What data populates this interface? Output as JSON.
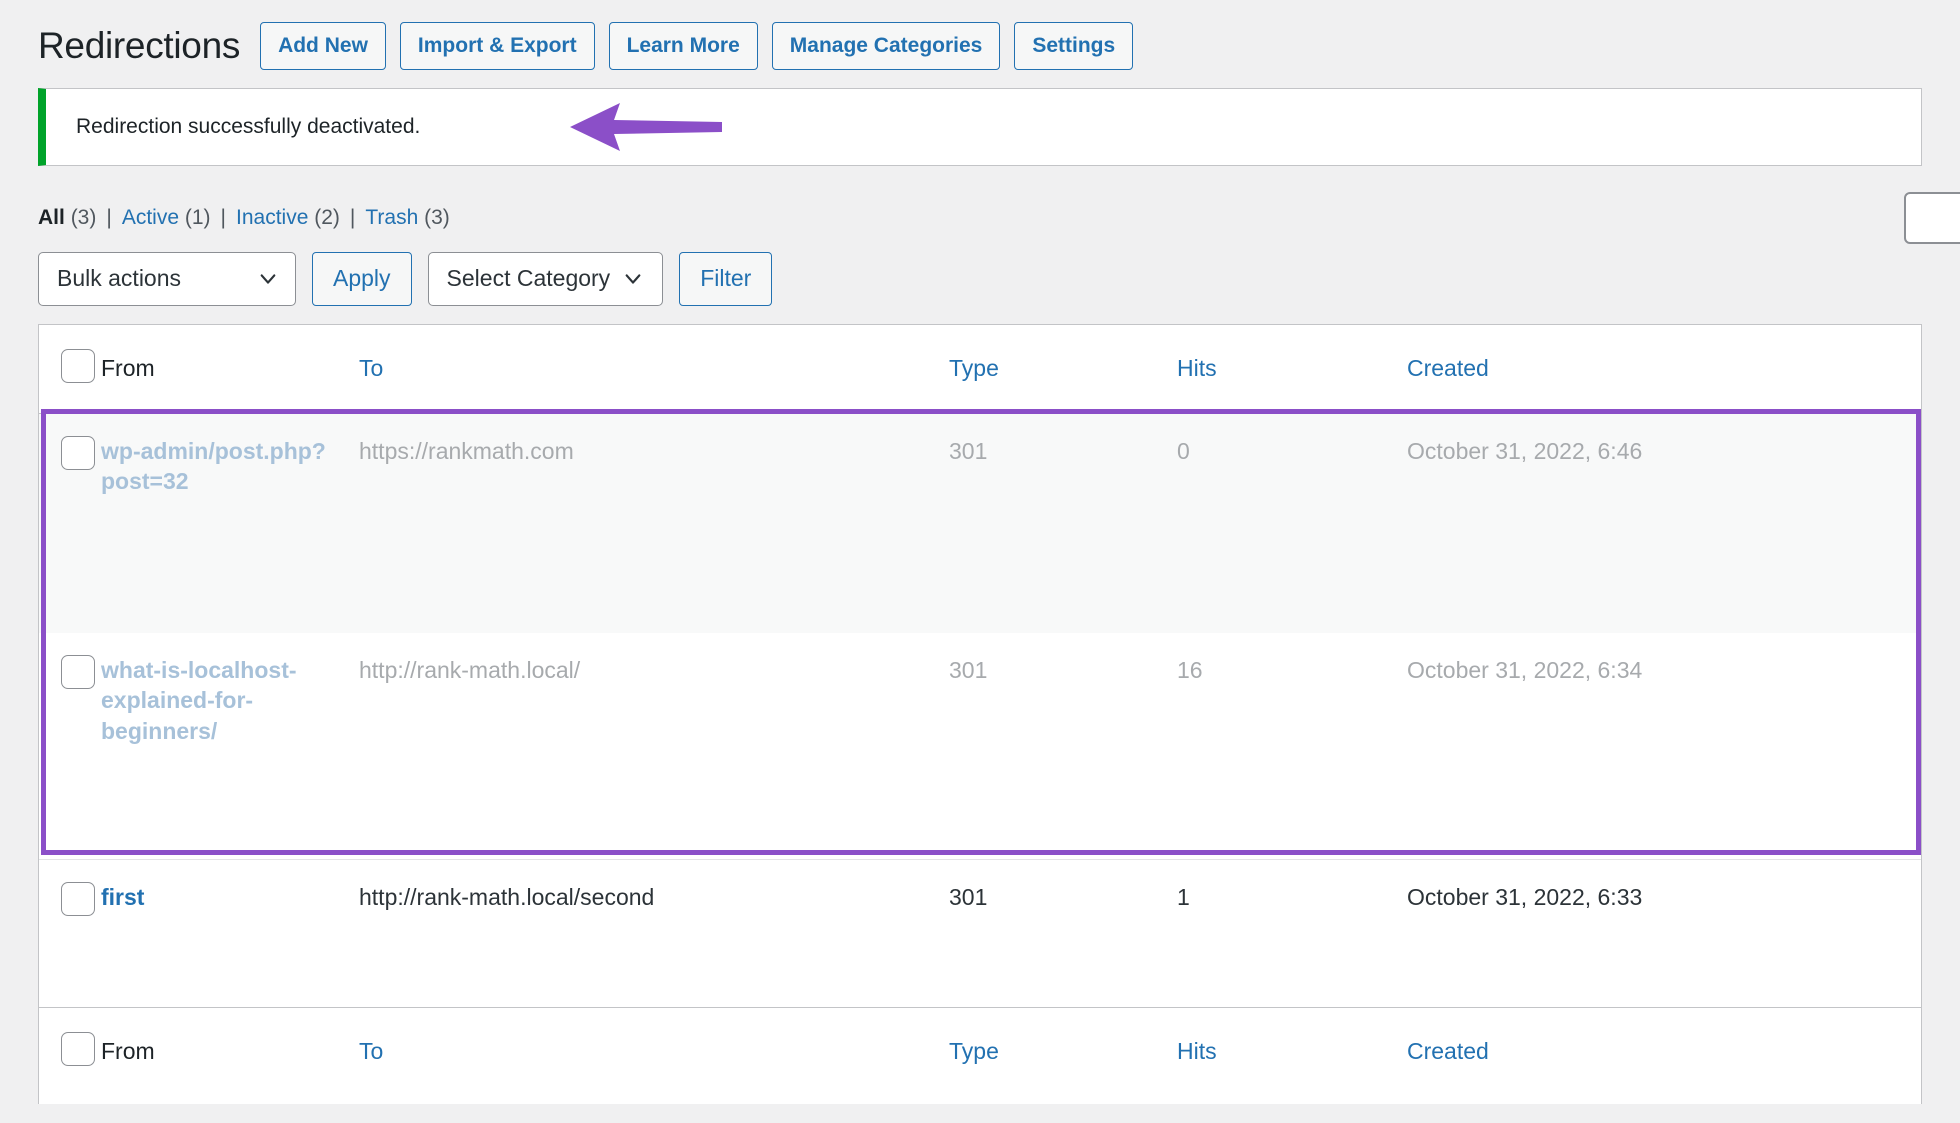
{
  "header": {
    "title": "Redirections",
    "actions": [
      {
        "label": "Add New",
        "name": "add-new-button"
      },
      {
        "label": "Import & Export",
        "name": "import-export-button"
      },
      {
        "label": "Learn More",
        "name": "learn-more-button"
      },
      {
        "label": "Manage Categories",
        "name": "manage-categories-button"
      },
      {
        "label": "Settings",
        "name": "settings-button"
      }
    ]
  },
  "notice": {
    "message": "Redirection successfully deactivated.",
    "accent_color": "#00a32a",
    "annotation_arrow_color": "#8b4fc8",
    "annotation_arrow_direction": "left"
  },
  "filters": {
    "links": [
      {
        "label": "All",
        "count": "(3)",
        "current": true
      },
      {
        "label": "Active",
        "count": "(1)",
        "current": false
      },
      {
        "label": "Inactive",
        "count": "(2)",
        "current": false
      },
      {
        "label": "Trash",
        "count": "(3)",
        "current": false
      }
    ],
    "separator": "|"
  },
  "search": {
    "value": "",
    "placeholder": ""
  },
  "tablenav": {
    "bulk_actions_label": "Bulk actions",
    "apply_label": "Apply",
    "select_category_label": "Select Category",
    "filter_label": "Filter"
  },
  "table": {
    "columns": {
      "from": "From",
      "to": "To",
      "type": "Type",
      "hits": "Hits",
      "created": "Created"
    },
    "rows": [
      {
        "from": "wp-admin/post.php?post=32",
        "to": "https://rankmath.com",
        "type": "301",
        "hits": "0",
        "created": "October 31, 2022, 6:46",
        "state": "inactive",
        "highlighted": true
      },
      {
        "from": "what-is-localhost-explained-for-beginners/",
        "to": "http://rank-math.local/",
        "type": "301",
        "hits": "16",
        "created": "October 31, 2022, 6:34",
        "state": "inactive",
        "highlighted": true
      },
      {
        "from": "first",
        "to": "http://rank-math.local/second",
        "type": "301",
        "hits": "1",
        "created": "October 31, 2022, 6:33",
        "state": "active",
        "highlighted": false
      }
    ]
  },
  "highlight": {
    "color": "#8b4fc8"
  }
}
